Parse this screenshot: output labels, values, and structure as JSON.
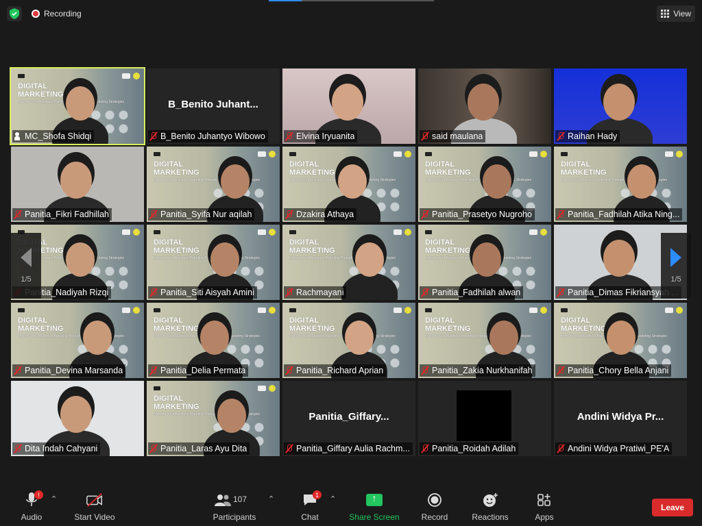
{
  "topbar": {
    "recording_label": "Recording",
    "view_label": "View"
  },
  "tiles": [
    {
      "name": "MC_Shofa Shidqi",
      "kind": "slide-speaker",
      "active": true
    },
    {
      "name": "B_Benito Juhantyo Wibowo",
      "big_name": "B_Benito  Juhant...",
      "kind": "name-only"
    },
    {
      "name": "Elvina Iryuanita",
      "kind": "video"
    },
    {
      "name": "said maulana",
      "kind": "video"
    },
    {
      "name": "Raihan Hady",
      "kind": "video"
    },
    {
      "name": "Panitia_Fikri Fadhillah",
      "kind": "video"
    },
    {
      "name": "Panitia_Syifa Nur aqilah",
      "kind": "slide"
    },
    {
      "name": "Dzakira Athaya",
      "kind": "slide"
    },
    {
      "name": "Panitia_Prasetyo Nugroho",
      "kind": "slide"
    },
    {
      "name": "Panitia_Fadhilah Atika Ning...",
      "kind": "slide"
    },
    {
      "name": "Panitia_Nadiyah Rizqi",
      "kind": "slide"
    },
    {
      "name": "Panitia_Siti Aisyah Amini",
      "kind": "slide"
    },
    {
      "name": "Rachmayani",
      "kind": "slide"
    },
    {
      "name": "Panitia_Fadhilah alwan",
      "kind": "slide"
    },
    {
      "name": "Panitia_Dimas Fikriansyah ...",
      "kind": "video"
    },
    {
      "name": "Panitia_Devina Marsanda",
      "kind": "slide"
    },
    {
      "name": "Panitia_Delia Permata",
      "kind": "slide"
    },
    {
      "name": "Panitia_Richard Aprian",
      "kind": "slide"
    },
    {
      "name": "Panitia_Zakia Nurkhanifah",
      "kind": "slide"
    },
    {
      "name": "Panitia_Chory Bella Anjani",
      "kind": "slide"
    },
    {
      "name": "Dita Indah Cahyani",
      "kind": "video"
    },
    {
      "name": "Panitia_Laras Ayu Dita",
      "kind": "slide"
    },
    {
      "name": "Panitia_Giffary Aulia Rachm...",
      "big_name": "Panitia_Giffary...",
      "kind": "name-only"
    },
    {
      "name": "Panitia_Roidah Adilah",
      "kind": "black"
    },
    {
      "name": "Andini Widya Pratiwi_PE'A",
      "big_name": "Andini  Widya  Pr...",
      "kind": "name-only"
    }
  ],
  "slide_text": {
    "title_line1": "DIGITAL",
    "title_line2": "MARKETING",
    "subtitle": "Improve Your Business Branding Through Digital Marketing Strategies"
  },
  "pager": {
    "left_count": "1/5",
    "right_count": "1/5"
  },
  "toolbar": {
    "audio_label": "Audio",
    "audio_badge": "!",
    "video_label": "Start Video",
    "participants_label": "Participants",
    "participants_count": "107",
    "chat_label": "Chat",
    "chat_badge": "1",
    "share_label": "Share Screen",
    "record_label": "Record",
    "reactions_label": "Reactions",
    "apps_label": "Apps",
    "leave_label": "Leave"
  },
  "colors": {
    "background": "#1a1a1a",
    "active_speaker_outline": "#d8ed5a",
    "share_green": "#22c55e",
    "leave_red": "#d92b2b",
    "muted_red": "#e02828",
    "nav_blue": "#2d8cff"
  }
}
